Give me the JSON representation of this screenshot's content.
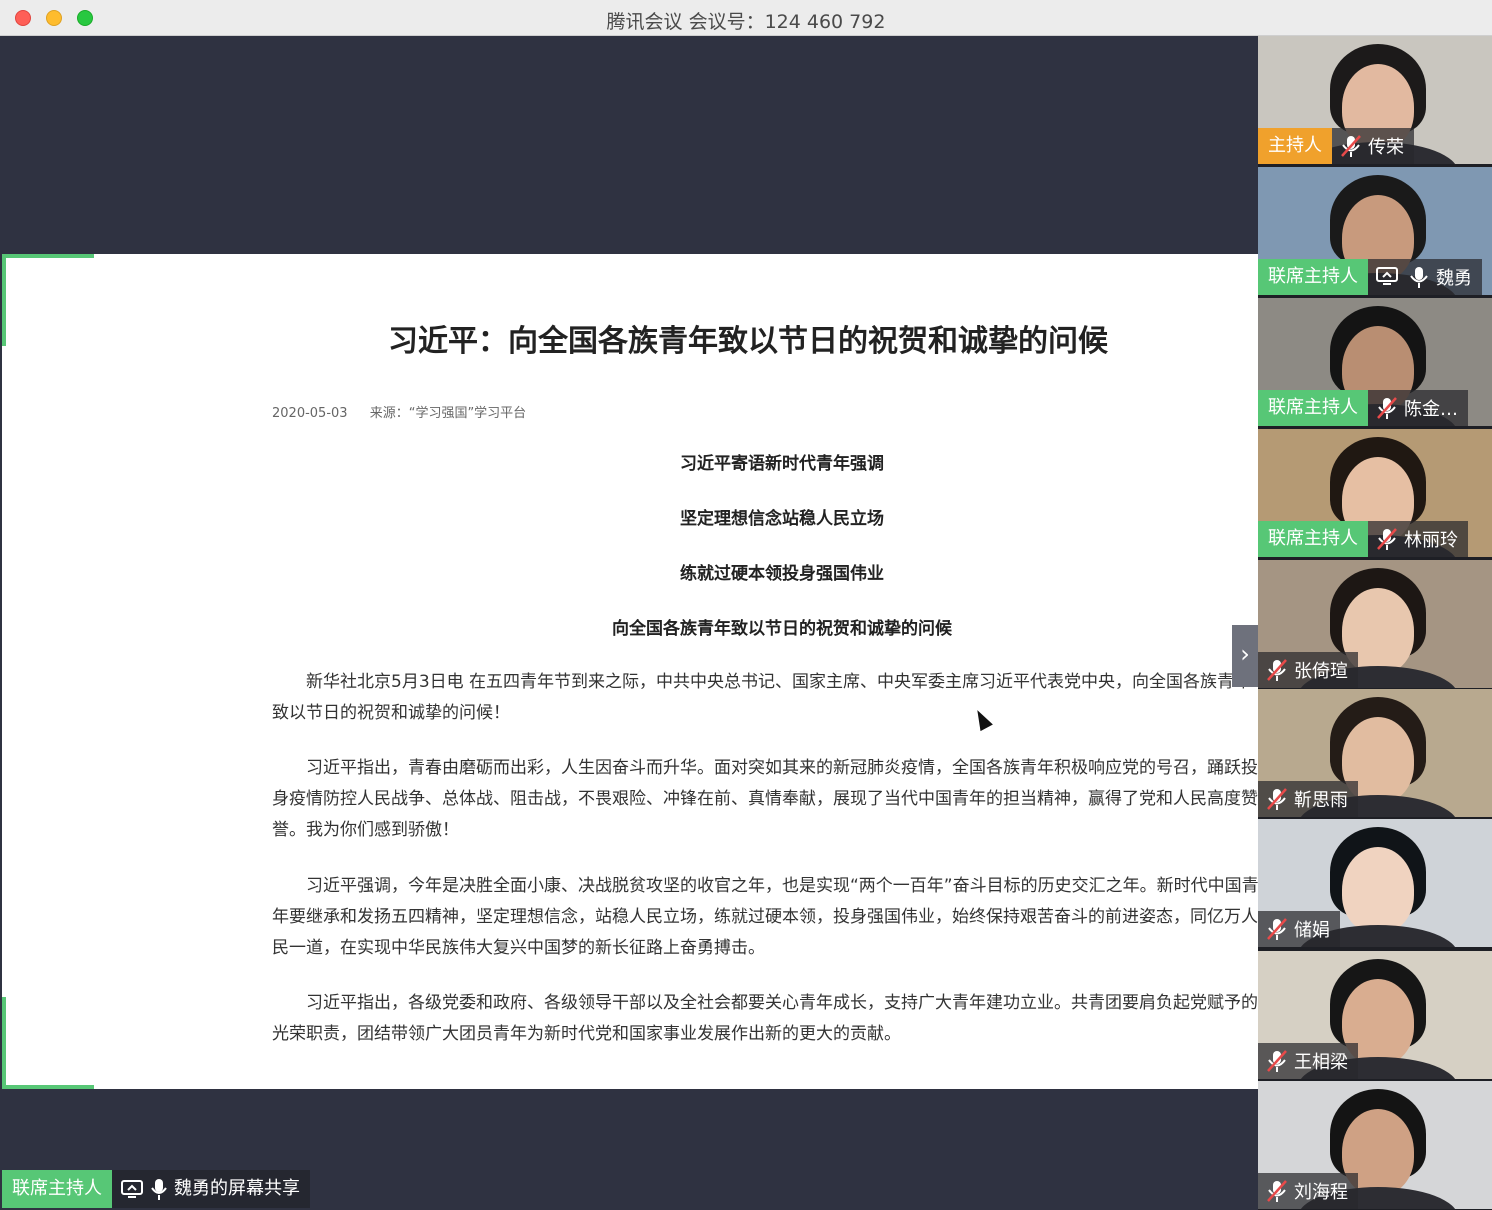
{
  "window": {
    "title": "腾讯会议 会议号：124 460 792"
  },
  "article": {
    "title": "习近平：向全国各族青年致以节日的祝贺和诚挚的问候",
    "date": "2020-05-03",
    "source": "来源：“学习强国”学习平台",
    "headlines": [
      "习近平寄语新时代青年强调",
      "坚定理想信念站稳人民立场",
      "练就过硬本领投身强国伟业",
      "向全国各族青年致以节日的祝贺和诚挚的问候"
    ],
    "paragraphs": [
      "新华社北京5月3日电 在五四青年节到来之际，中共中央总书记、国家主席、中央军委主席习近平代表党中央，向全国各族青年致以节日的祝贺和诚挚的问候！",
      "习近平指出，青春由磨砺而出彩，人生因奋斗而升华。面对突如其来的新冠肺炎疫情，全国各族青年积极响应党的号召，踊跃投身疫情防控人民战争、总体战、阻击战，不畏艰险、冲锋在前、真情奉献，展现了当代中国青年的担当精神，赢得了党和人民高度赞誉。我为你们感到骄傲！",
      "习近平强调，今年是决胜全面小康、决战脱贫攻坚的收官之年，也是实现“两个一百年”奋斗目标的历史交汇之年。新时代中国青年要继承和发扬五四精神，坚定理想信念，站稳人民立场，练就过硬本领，投身强国伟业，始终保持艰苦奋斗的前进姿态，同亿万人民一道，在实现中华民族伟大复兴中国梦的新长征路上奋勇搏击。",
      "习近平指出，各级党委和政府、各级领导干部以及全社会都要关心青年成长，支持广大青年建功立业。共青团要肩负起党赋予的光荣职责，团结带领广大团员青年为新时代党和国家事业发展作出新的更大的贡献。"
    ]
  },
  "share_bar": {
    "role": "联席主持人",
    "label": "魏勇的屏幕共享"
  },
  "participants": [
    {
      "role": "主持人",
      "name": "传荣",
      "mic": "muted",
      "bg": "#c9c6bf",
      "skin": "#e2b9a0",
      "hair": "#1c1a1a"
    },
    {
      "role": "联席主持人",
      "name": "魏勇",
      "mic": "on",
      "sharing": true,
      "bg": "#7f98b2",
      "skin": "#c89a7d",
      "hair": "#1a1a1a"
    },
    {
      "role": "联席主持人",
      "name": "陈金…",
      "mic": "muted",
      "bg": "#8d8a84",
      "skin": "#b98e72",
      "hair": "#141414"
    },
    {
      "role": "联席主持人",
      "name": "林丽玲",
      "mic": "muted",
      "bg": "#b59a74",
      "skin": "#e6bfa3",
      "hair": "#201812"
    },
    {
      "role": "",
      "name": "张倚瑄",
      "mic": "muted",
      "bg": "#a59583",
      "skin": "#e8c7ae",
      "hair": "#1d1714"
    },
    {
      "role": "",
      "name": "靳思雨",
      "mic": "muted",
      "bg": "#b8a98f",
      "skin": "#e1bca0",
      "hair": "#241c17"
    },
    {
      "role": "",
      "name": "储娟",
      "mic": "muted",
      "bg": "#cfd3d8",
      "skin": "#f0d3c0",
      "hair": "#101418"
    },
    {
      "role": "",
      "name": "王相梁",
      "mic": "muted",
      "bg": "#d6d0c4",
      "skin": "#d9ad90",
      "hair": "#161616"
    },
    {
      "role": "",
      "name": "刘海程",
      "mic": "muted",
      "bg": "#d5d6d8",
      "skin": "#cfa184",
      "hair": "#141414"
    }
  ],
  "colors": {
    "host": "#f0a12c",
    "cohost": "#57c776",
    "stage": "#2f3241"
  }
}
